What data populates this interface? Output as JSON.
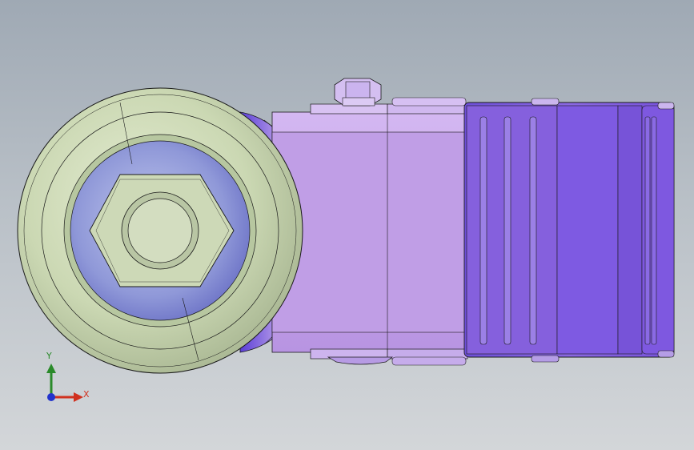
{
  "viewport": {
    "background_top": "#9fa9b4",
    "background_bottom": "#d3d6d9"
  },
  "model": {
    "wheel_color": "#cfdcb8",
    "wheel_shadow_color": "#8a93c8",
    "body_color": "#c4a3e6",
    "body_dark_color": "#8a5fe0",
    "bracket_color": "#7f5de0",
    "edge_color": "#1a1a1a"
  },
  "triad": {
    "x_label": "X",
    "y_label": "Y",
    "x_color": "#d0311f",
    "y_color": "#2a8a2a",
    "origin_color": "#2233cc"
  }
}
